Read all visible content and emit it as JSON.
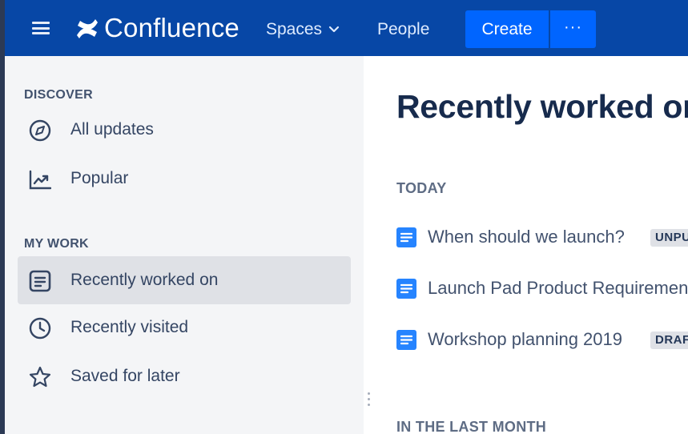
{
  "topnav": {
    "brand": "Confluence",
    "spaces_label": "Spaces",
    "people_label": "People",
    "create_label": "Create",
    "more_label": "···",
    "colors": {
      "background": "#0747a6",
      "button": "#0065ff"
    }
  },
  "sidebar": {
    "discover_heading": "DISCOVER",
    "my_work_heading": "MY WORK",
    "items": [
      {
        "label": "All updates",
        "icon": "compass-icon"
      },
      {
        "label": "Popular",
        "icon": "trending-chart-icon"
      },
      {
        "label": "Recently worked on",
        "icon": "document-icon",
        "active": true
      },
      {
        "label": "Recently visited",
        "icon": "clock-icon"
      },
      {
        "label": "Saved for later",
        "icon": "star-icon"
      }
    ]
  },
  "main": {
    "title": "Recently worked on",
    "sections": [
      {
        "heading": "TODAY",
        "items": [
          {
            "title": "When should we launch?",
            "lozenge": "UNPUBLISHED"
          },
          {
            "title": "Launch Pad Product Requirements",
            "lozenge": ""
          },
          {
            "title": "Workshop planning 2019",
            "lozenge": "DRAFT"
          }
        ]
      },
      {
        "heading": "IN THE LAST MONTH",
        "items": []
      }
    ]
  }
}
